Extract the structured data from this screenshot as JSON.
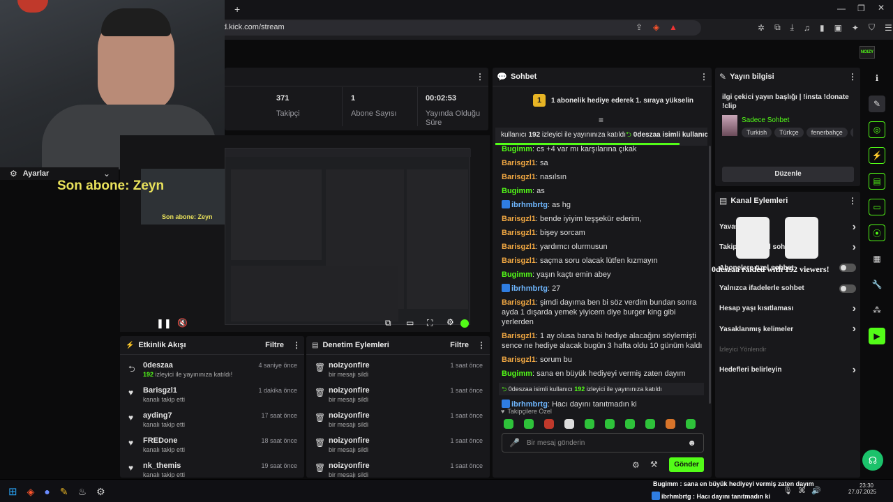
{
  "browser": {
    "url": "d.kick.com/stream",
    "new_tab": "+"
  },
  "overlay": {
    "settings_label": "Ayarlar",
    "last_sub": "Son abone: Zeyn",
    "raid_text": "0deszaa raided with 192 viewers!"
  },
  "stats": [
    {
      "value": "371",
      "label": "Takipçi"
    },
    {
      "value": "1",
      "label": "Abone Sayısı"
    },
    {
      "value": "00:02:53",
      "label": "Yayında Olduğu Süre"
    }
  ],
  "stats_menu": "⋮",
  "activity": {
    "title": "Etkinlik Akışı",
    "filter": "Filtre",
    "items": [
      {
        "name": "0deszaa",
        "desc_prefix": "192",
        "desc": " izleyici ile yayınınıza katıldı!",
        "time": "4 saniye önce"
      },
      {
        "name": "Barisgzl1",
        "desc": "kanalı takip etti",
        "time": "1 dakika önce"
      },
      {
        "name": "ayding7",
        "desc": "kanalı takip etti",
        "time": "17 saat önce"
      },
      {
        "name": "FREDone",
        "desc": "kanalı takip etti",
        "time": "18 saat önce"
      },
      {
        "name": "nk_themis",
        "desc": "kanalı takip etti",
        "time": "19 saat önce"
      }
    ]
  },
  "moderation": {
    "title": "Denetim Eylemleri",
    "filter": "Filtre",
    "items": [
      {
        "name": "noizyonfire",
        "desc": "bir mesajı sildi",
        "time": "1 saat önce"
      },
      {
        "name": "noizyonfire",
        "desc": "bir mesajı sildi",
        "time": "1 saat önce"
      },
      {
        "name": "noizyonfire",
        "desc": "bir mesajı sildi",
        "time": "1 saat önce"
      },
      {
        "name": "noizyonfire",
        "desc": "bir mesajı sildi",
        "time": "1 saat önce"
      },
      {
        "name": "noizyonfire",
        "desc": "bir mesajı sildi",
        "time": "1 saat önce"
      }
    ]
  },
  "chat": {
    "title": "Sohbet",
    "pinned": "1 abonelik hediye ederek 1. sıraya yükselin",
    "pinned_count": "1",
    "marquee_pre": "kullanıcı ",
    "marquee_num": "192",
    "marquee_mid": " izleyici ile yayınınıza katıldı",
    "marquee_post": " 0deszaa isimli kullanıc",
    "messages": [
      {
        "user": "Bugimm",
        "color": "green",
        "badge": false,
        "text": ": cs +4 var mı karşılarına çıkak"
      },
      {
        "user": "Barisgzl1",
        "color": "orange",
        "badge": false,
        "text": ": sa"
      },
      {
        "user": "Barisgzl1",
        "color": "orange",
        "badge": false,
        "text": ": nasılsın"
      },
      {
        "user": "Bugimm",
        "color": "green",
        "badge": false,
        "text": ": as"
      },
      {
        "user": "ibrhmbrtg",
        "color": "blue",
        "badge": true,
        "text": ": as hg"
      },
      {
        "user": "Barisgzl1",
        "color": "orange",
        "badge": false,
        "text": ": bende iyiyim teşşekür ederim,"
      },
      {
        "user": "Barisgzl1",
        "color": "orange",
        "badge": false,
        "text": ": bişey sorcam"
      },
      {
        "user": "Barisgzl1",
        "color": "orange",
        "badge": false,
        "text": ": yardımcı olurmusun"
      },
      {
        "user": "Barisgzl1",
        "color": "orange",
        "badge": false,
        "text": ": saçma soru olacak lütfen kızmayın"
      },
      {
        "user": "Bugimm",
        "color": "green",
        "badge": false,
        "text": ": yaşın kaçtı emin abey"
      },
      {
        "user": "ibrhmbrtg",
        "color": "blue",
        "badge": true,
        "text": ": 27"
      },
      {
        "user": "Barisgzl1",
        "color": "orange",
        "badge": false,
        "text": ": şimdi dayıma ben bi söz verdim bundan sonra ayda 1 dışarda yemek yiyicem diye burger king gibi yerlerden"
      },
      {
        "user": "Barisgzl1",
        "color": "orange",
        "badge": false,
        "text": ": 1 ay olusa bana bi hediye alacağını söylemişti sence ne hediye alacak bugün 3 hafta oldu 10 günüm kaldı"
      },
      {
        "user": "Barisgzl1",
        "color": "orange",
        "badge": false,
        "text": ": sorum bu"
      },
      {
        "user": "Bugimm",
        "color": "green",
        "badge": false,
        "text": ": sana en büyük hediyeyi vermiş zaten dayım"
      }
    ],
    "system": {
      "pre": "0deszaa isimli kullanıcı ",
      "num": "192",
      "post": " izleyici ile yayınınıza katıldı"
    },
    "last": {
      "user": "ibrhmbrtg",
      "text": ": Hacı dayını tanıtmadın ki"
    },
    "followers_only": "Takipçilere Özel",
    "input_placeholder": "Bir mesaj gönderin",
    "send": "Gönder"
  },
  "stream_info": {
    "title": "Yayın bilgisi",
    "stream_title": "ilgi çekici yayın başlığı | !insta !donate !clip",
    "mode": "Sadece Sohbet",
    "tags": [
      "Turkish",
      "Türkçe",
      "fenerbahçe",
      "M"
    ],
    "edit": "Düzenle"
  },
  "channel_actions": {
    "title": "Kanal Eylemleri",
    "items": [
      {
        "label": "Yavaş mod",
        "kind": "chevron"
      },
      {
        "label": "Takipçilere özel sohbet",
        "kind": "chevron"
      },
      {
        "label": "Abonelere özel sohbet",
        "kind": "toggle"
      },
      {
        "label": "Yalnızca ifadelerle sohbet",
        "kind": "toggle"
      },
      {
        "label": "Hesap yaşı kısıtlaması",
        "kind": "chevron"
      },
      {
        "label": "Yasaklanmış kelimeler",
        "kind": "chevron"
      },
      {
        "label": "İzleyici Yönlendir",
        "kind": "disabled"
      },
      {
        "label": "Hedefleri belirleyin",
        "kind": "chevron"
      }
    ]
  },
  "taskbar": {
    "notif1_user": "Bugimm",
    "notif1_text": " : sana en büyük hediyeyi vermiş zaten dayım",
    "notif2_user": "ibrhmbrtg",
    "notif2_text": " : Hacı dayını tanıtmadın ki",
    "time": "23:30",
    "date": "27.07.2025"
  },
  "colors": {
    "accent": "#53fc18",
    "panel": "#18181b",
    "bg": "#0b0b0c"
  }
}
